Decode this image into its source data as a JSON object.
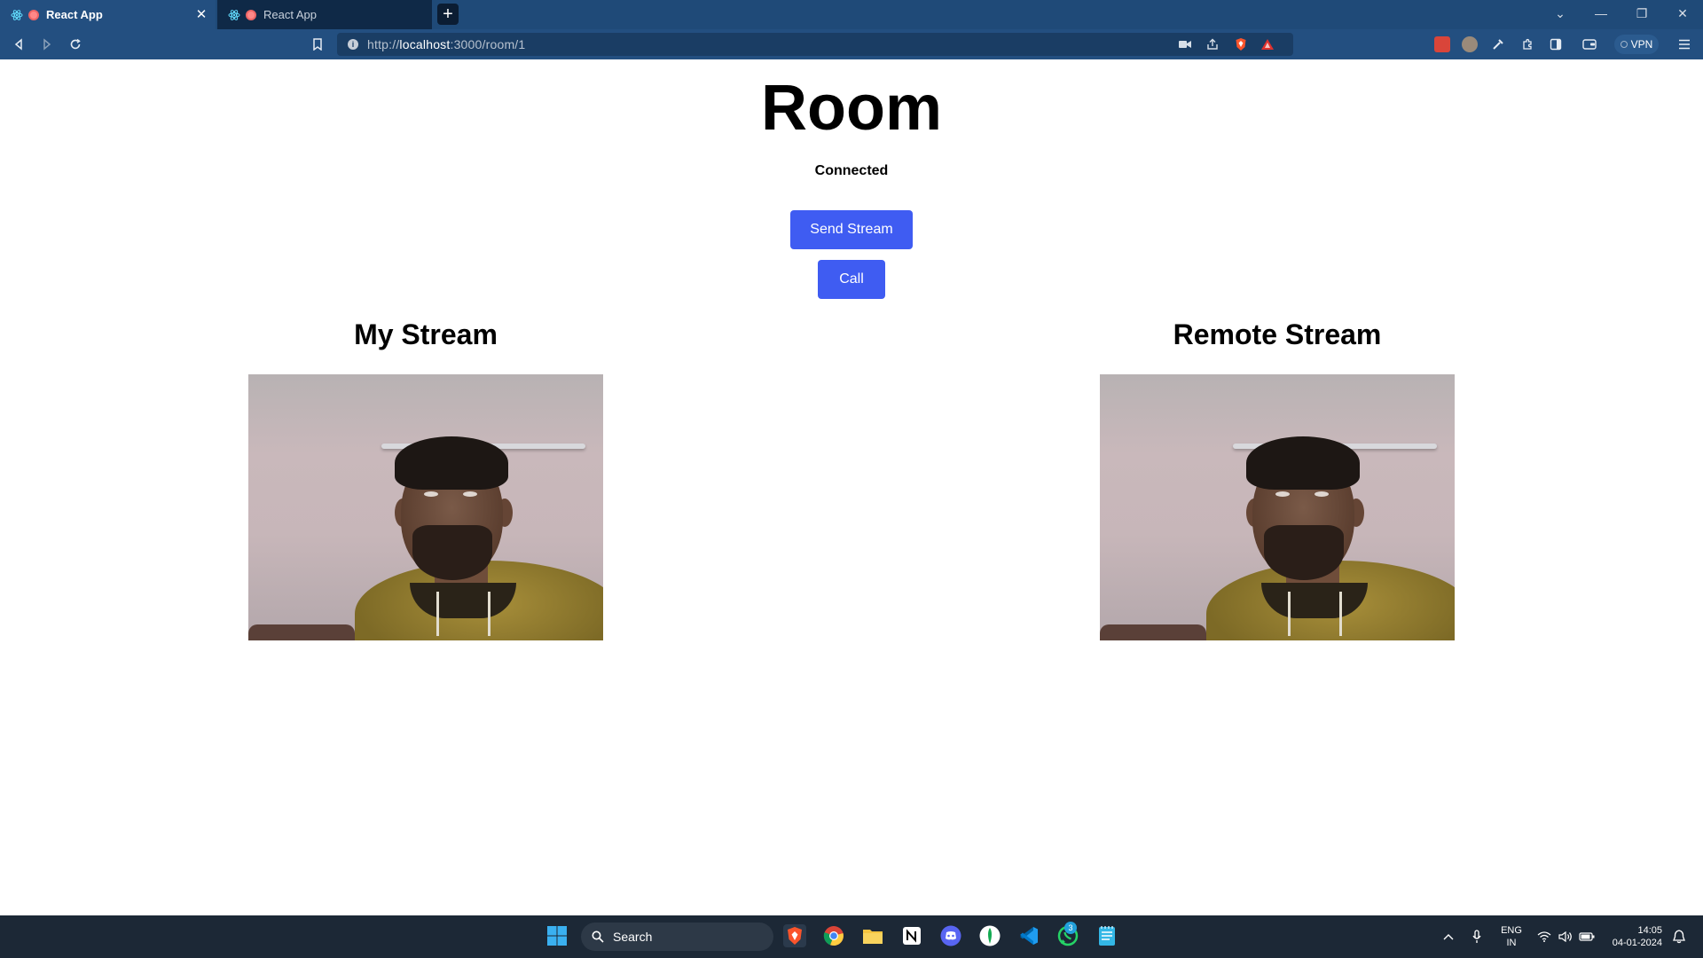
{
  "browser": {
    "tabs": [
      {
        "label": "React App",
        "active": true
      },
      {
        "label": "React App",
        "active": false
      }
    ],
    "new_tab_symbol": "+",
    "url": {
      "scheme": "http://",
      "host": "localhost",
      "rest": ":3000/room/1"
    },
    "vpn_label": "VPN",
    "icons": [
      "back-icon",
      "forward-icon",
      "reload-icon",
      "bookmark-icon",
      "camera-icon",
      "share-icon",
      "brave-shields-icon",
      "brave-rewards-icon",
      "extension-icon",
      "sidebar-icon",
      "wallet-icon",
      "menu-icon"
    ]
  },
  "page": {
    "title": "Room",
    "status": "Connected",
    "buttons": {
      "send_stream": "Send Stream",
      "call": "Call"
    },
    "streams": {
      "mine": {
        "title": "My Stream"
      },
      "remote": {
        "title": "Remote Stream"
      }
    }
  },
  "taskbar": {
    "search_placeholder": "Search",
    "apps": [
      "windows-start-icon",
      "brave-icon",
      "chrome-icon",
      "file-explorer-icon",
      "notion-icon",
      "discord-icon",
      "mongodb-compass-icon",
      "vscode-icon",
      "whatsapp-icon",
      "notepad-icon"
    ],
    "whatsapp_badge": "3",
    "language": {
      "line1": "ENG",
      "line2": "IN"
    },
    "time": "14:05",
    "date": "04-01-2024"
  },
  "colors": {
    "accent_button": "#3f5cf2",
    "tabbar": "#1f4a78",
    "taskbar": "#1c2836"
  }
}
